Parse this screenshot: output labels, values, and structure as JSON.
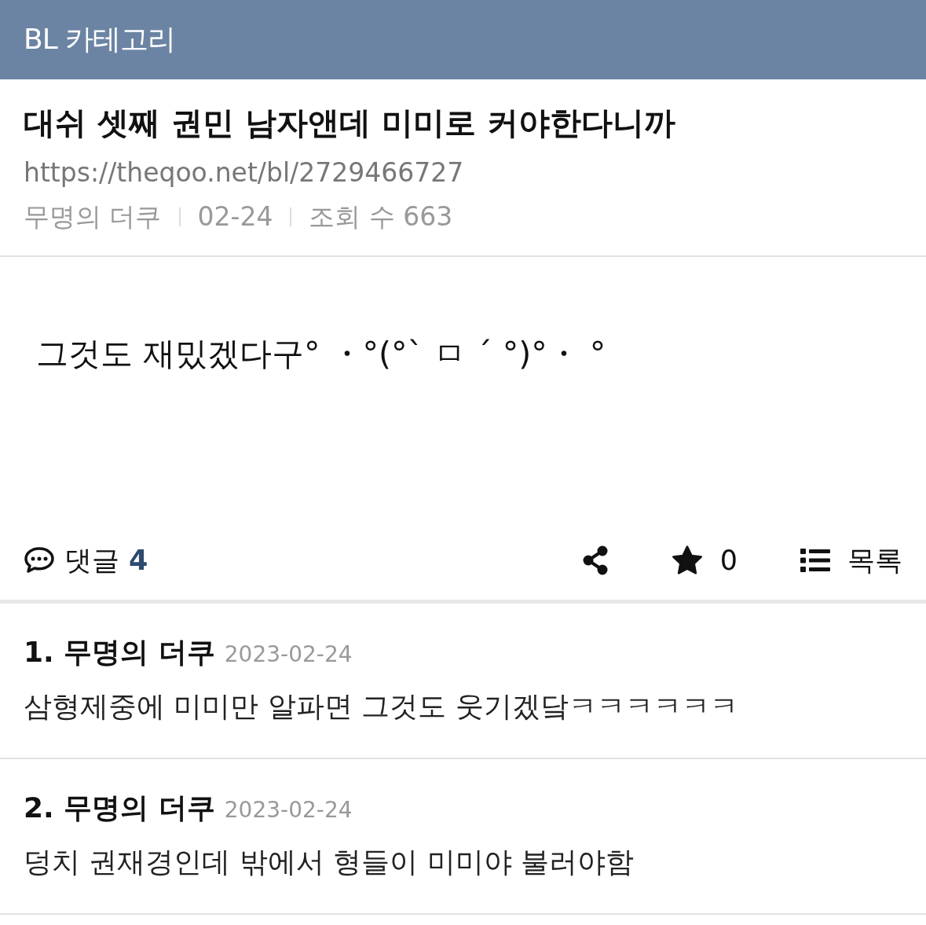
{
  "header": {
    "title": "BL 카테고리"
  },
  "post": {
    "title": "대쉬 셋째 권민 남자앤데 미미로 커야한다니까",
    "url": "https://theqoo.net/bl/2729466727",
    "meta": [
      "무명의 더쿠",
      "02-24",
      "조회 수 663"
    ],
    "body": "그것도 재밌겠다구° ・°(°` ㅁ ´ °)°・ °"
  },
  "actions": {
    "comments_label": "댓글",
    "comments_count": "4",
    "star_count": "0",
    "list_label": "목록"
  },
  "comments": [
    {
      "author": "1. 무명의 더쿠",
      "date": "2023-02-24",
      "text": "삼형제중에 미미만 알파면 그것도 웃기겠닼ㅋㅋㅋㅋㅋㅋ"
    },
    {
      "author": "2. 무명의 더쿠",
      "date": "2023-02-24",
      "text": "덩치 권재경인데 밖에서 형들이 미미야 불러야함"
    }
  ]
}
